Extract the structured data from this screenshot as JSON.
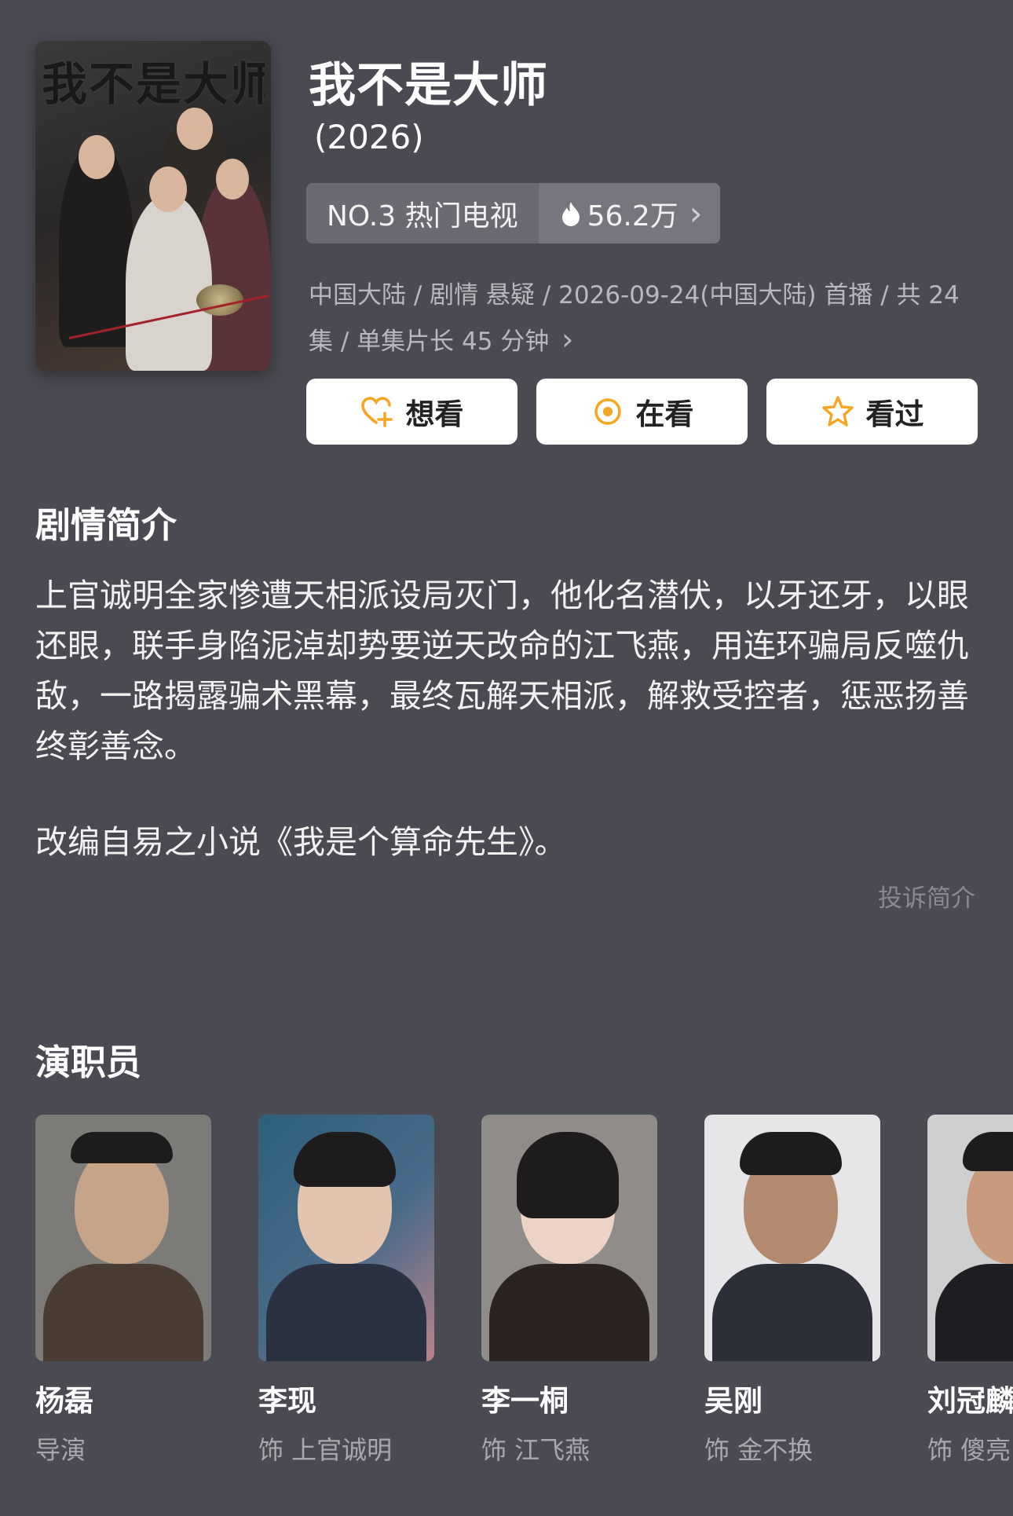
{
  "show": {
    "poster_title": "我不是大师",
    "title": "我不是大师",
    "year": "(2026)",
    "rank": "NO.3 热门电视",
    "heat": "56.2万",
    "meta": "中国大陆 / 剧情 悬疑 / 2026-09-24(中国大陆) 首播 / 共 24 集 / 单集片长 45 分钟",
    "meta_chevron": "›",
    "heat_chevron": "›"
  },
  "actions": [
    {
      "label": "想看",
      "icon": "heart-plus-icon",
      "color": "#f5a623"
    },
    {
      "label": "在看",
      "icon": "target-icon",
      "color": "#f5a623"
    },
    {
      "label": "看过",
      "icon": "star-icon",
      "color": "#f5a623"
    }
  ],
  "synopsis": {
    "heading": "剧情简介",
    "body": "上官诚明全家惨遭天相派设局灭门，他化名潜伏，以牙还牙，以眼还眼，联手身陷泥淖却势要逆天改命的江飞燕，用连环骗局反噬仇敌，一路揭露骗术黑幕，最终瓦解天相派，解救受控者，惩恶扬善终彰善念。",
    "adapted": "改编自易之小说《我是个算命先生》。",
    "report": "投诉简介"
  },
  "cast": {
    "heading": "演职员",
    "members": [
      {
        "name": "杨磊",
        "role": "导演"
      },
      {
        "name": "李现",
        "role": "饰 上官诚明"
      },
      {
        "name": "李一桐",
        "role": "饰 江飞燕"
      },
      {
        "name": "吴刚",
        "role": "饰 金不换"
      },
      {
        "name": "刘冠麟",
        "role": "饰 傻亮"
      }
    ]
  },
  "colors": {
    "background": "#4a4a52",
    "accent": "#f5a623"
  }
}
